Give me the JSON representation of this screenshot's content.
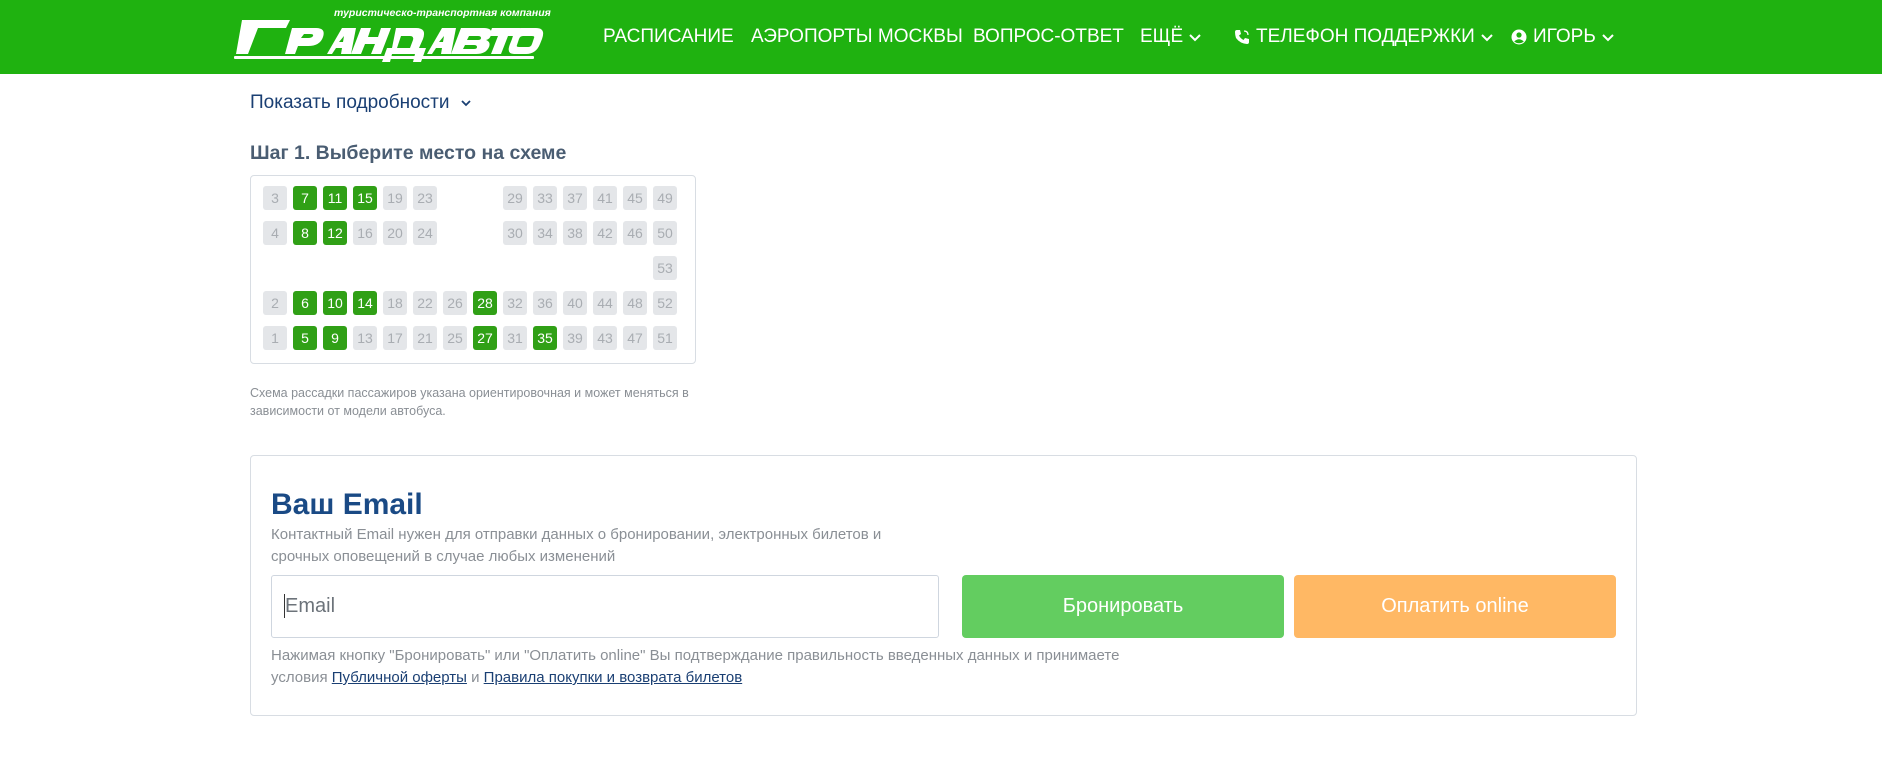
{
  "header": {
    "logo_tagline": "туристическо-транспортная компания",
    "logo_text": "ГРАНДАВТО",
    "nav": {
      "schedule": "РАСПИСАНИЕ",
      "airports": "АЭРОПОРТЫ МОСКВЫ",
      "faq": "ВОПРОС-ОТВЕТ",
      "more": "ЕЩЁ",
      "support": "ТЕЛЕФОН ПОДДЕРЖКИ",
      "user": "ИГОРЬ"
    },
    "icons": {
      "phone": "phone-icon",
      "user": "user-circle-icon",
      "chevron": "chevron-down-icon"
    },
    "bg_color": "#1fb210"
  },
  "details_toggle": "Показать подробности",
  "step1_title": "Шаг 1. Выберите место на схеме",
  "seatmap": {
    "free_color": "#30a016",
    "busy_color": "#e4e6e9",
    "rows": [
      [
        {
          "n": "3",
          "free": false
        },
        {
          "n": "7",
          "free": true
        },
        {
          "n": "11",
          "free": true
        },
        {
          "n": "15",
          "free": true
        },
        {
          "n": "19",
          "free": false
        },
        {
          "n": "23",
          "free": false
        },
        {
          "n": "29",
          "free": false
        },
        {
          "n": "33",
          "free": false
        },
        {
          "n": "37",
          "free": false
        },
        {
          "n": "41",
          "free": false
        },
        {
          "n": "45",
          "free": false
        },
        {
          "n": "49",
          "free": false
        }
      ],
      [
        {
          "n": "4",
          "free": false
        },
        {
          "n": "8",
          "free": true
        },
        {
          "n": "12",
          "free": true
        },
        {
          "n": "16",
          "free": false
        },
        {
          "n": "20",
          "free": false
        },
        {
          "n": "24",
          "free": false
        },
        {
          "n": "30",
          "free": false
        },
        {
          "n": "34",
          "free": false
        },
        {
          "n": "38",
          "free": false
        },
        {
          "n": "42",
          "free": false
        },
        {
          "n": "46",
          "free": false
        },
        {
          "n": "50",
          "free": false
        }
      ],
      [
        {
          "n": "53",
          "free": false
        }
      ],
      [
        {
          "n": "2",
          "free": false
        },
        {
          "n": "6",
          "free": true
        },
        {
          "n": "10",
          "free": true
        },
        {
          "n": "14",
          "free": true
        },
        {
          "n": "18",
          "free": false
        },
        {
          "n": "22",
          "free": false
        },
        {
          "n": "26",
          "free": false
        },
        {
          "n": "28",
          "free": true
        },
        {
          "n": "32",
          "free": false
        },
        {
          "n": "36",
          "free": false
        },
        {
          "n": "40",
          "free": false
        },
        {
          "n": "44",
          "free": false
        },
        {
          "n": "48",
          "free": false
        },
        {
          "n": "52",
          "free": false
        }
      ],
      [
        {
          "n": "1",
          "free": false
        },
        {
          "n": "5",
          "free": true
        },
        {
          "n": "9",
          "free": true
        },
        {
          "n": "13",
          "free": false
        },
        {
          "n": "17",
          "free": false
        },
        {
          "n": "21",
          "free": false
        },
        {
          "n": "25",
          "free": false
        },
        {
          "n": "27",
          "free": true
        },
        {
          "n": "31",
          "free": false
        },
        {
          "n": "35",
          "free": true
        },
        {
          "n": "39",
          "free": false
        },
        {
          "n": "43",
          "free": false
        },
        {
          "n": "47",
          "free": false
        },
        {
          "n": "51",
          "free": false
        }
      ]
    ]
  },
  "seat_disclaimer": "Схема рассадки пассажиров указана ориентировочная и может меняться в зависимости от модели автобуса.",
  "email_section": {
    "title": "Ваш Email",
    "description": "Контактный Email нужен для отправки данных о бронировании, электронных билетов и срочных оповещений в случае любых изменений",
    "input_placeholder": "Email",
    "input_value": "",
    "book_label": "Бронировать",
    "pay_label": "Оплатить online",
    "book_color": "#63cd60",
    "pay_color": "#ffb864",
    "terms_prefix": "Нажимая кнопку \"Бронировать\" или \"Оплатить online\" Вы подтверждание правильность введенных данных и принимаете условия",
    "terms_link_offer": "Публичной оферты",
    "terms_and": "и",
    "terms_link_rules": "Правила покупки и возврата билетов"
  }
}
